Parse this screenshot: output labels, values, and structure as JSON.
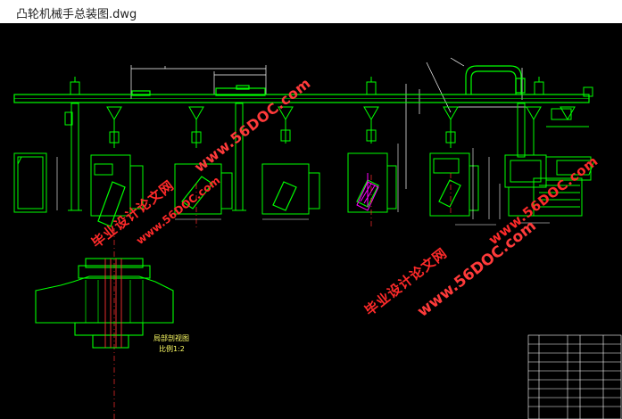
{
  "window": {
    "title": "凸轮机械手总装图.dwg"
  },
  "drawing": {
    "detail_caption": "局部剖视图",
    "detail_scale": "比例1:2"
  },
  "watermarks": {
    "site_name": "毕业设计论文网",
    "url": "www.56DOC.com"
  },
  "colors": {
    "canvas_background": "#000000",
    "primary_lines": "#00ff00",
    "dimension_lines": "#ffffff",
    "hatch_lines": "#ff00ff",
    "watermark": "#ff2a2a"
  }
}
